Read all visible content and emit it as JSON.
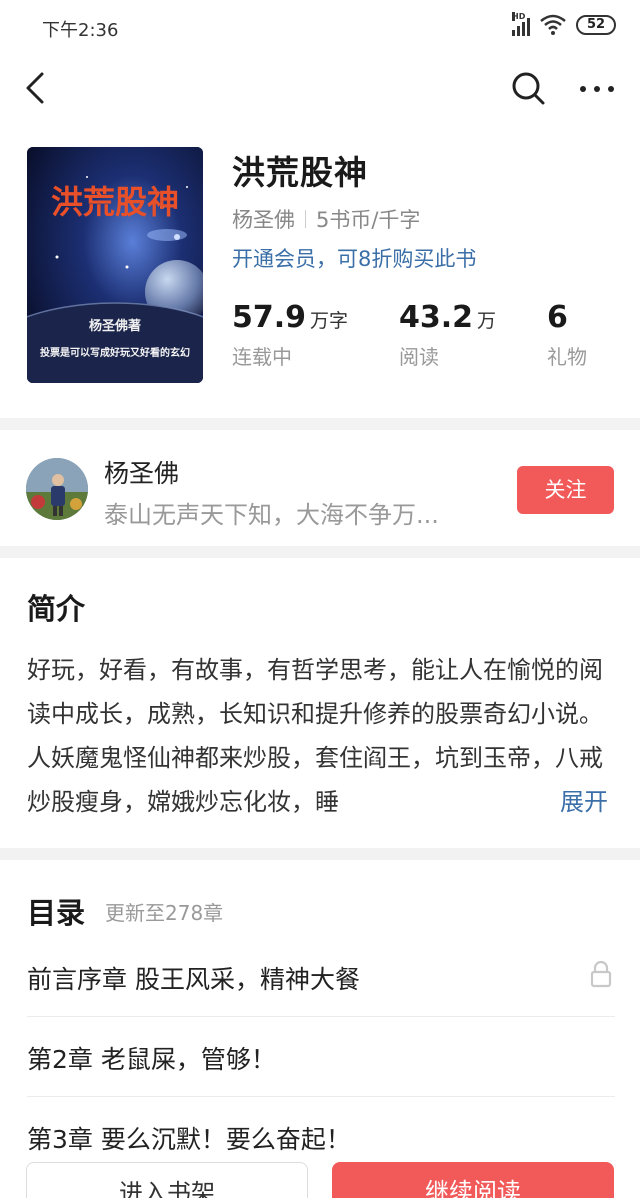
{
  "status_bar": {
    "time": "下午2:36",
    "network": "HD",
    "battery": "52"
  },
  "header": {
    "back_icon": "chevron-left-icon",
    "search_icon": "search-icon",
    "more_icon": "more-horizontal-icon"
  },
  "book": {
    "title": "洪荒股神",
    "cover_title": "洪荒股神",
    "cover_author": "杨圣佛著",
    "cover_tagline": "投票是可以写成好玩又好看的玄幻",
    "author": "杨圣佛",
    "price": "5书币/千字",
    "vip_offer": "开通会员，可8折购买此书",
    "stats": [
      {
        "value": "57.9",
        "unit": "万字",
        "label": "连载中"
      },
      {
        "value": "43.2",
        "unit": "万",
        "label": "阅读"
      },
      {
        "value": "6",
        "unit": "",
        "label": "礼物"
      }
    ]
  },
  "author_card": {
    "name": "杨圣佛",
    "motto": "泰山无声天下知，大海不争万...",
    "follow_label": "关注"
  },
  "synopsis": {
    "title": "简介",
    "text": "好玩，好看，有故事，有哲学思考，能让人在愉悦的阅读中成长，成熟，长知识和提升修养的股票奇幻小说。人妖魔鬼怪仙神都来炒股，套住阎王，坑到玉帝，八戒炒股瘦身，嫦娥炒忘化妆，睡",
    "expand_label": "展开"
  },
  "toc": {
    "title": "目录",
    "update": "更新至278章",
    "chapters": [
      {
        "label": "前言序章 股王风采，精神大餐",
        "locked": true
      },
      {
        "label": "第2章 老鼠屎，管够！",
        "locked": false
      },
      {
        "label": "第3章 要么沉默！要么奋起！",
        "locked": false
      }
    ]
  },
  "bottom_bar": {
    "shelf_label": "进入书架",
    "read_label": "继续阅读"
  },
  "colors": {
    "accent": "#f25a5a",
    "link": "#3b6fa8",
    "muted": "#999999",
    "divider": "#f2f2f2"
  }
}
